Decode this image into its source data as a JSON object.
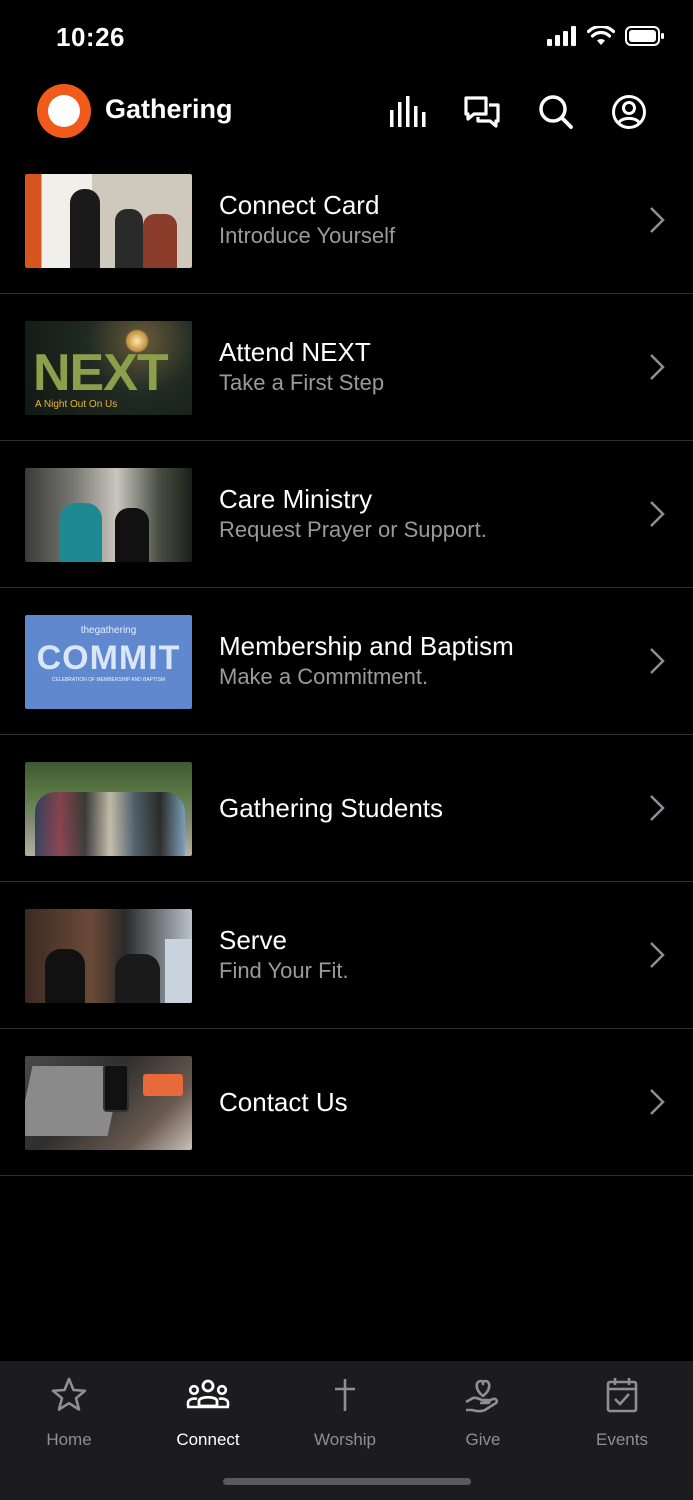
{
  "status_bar": {
    "time": "10:26"
  },
  "header": {
    "app_name": "Gathering"
  },
  "items": [
    {
      "title": "Connect Card",
      "subtitle": "Introduce Yourself"
    },
    {
      "title": "Attend NEXT",
      "subtitle": "Take a First Step",
      "thumb_text": "NEXT",
      "thumb_caption": "A Night Out On Us"
    },
    {
      "title": "Care Ministry",
      "subtitle": "Request Prayer or Support."
    },
    {
      "title": "Membership and Baptism",
      "subtitle": "Make a Commitment.",
      "thumb_brand": "thegathering",
      "thumb_text": "COMMIT",
      "thumb_caption": "CELEBRATION OF MEMBERSHIP AND BAPTISM"
    },
    {
      "title": "Gathering Students",
      "subtitle": ""
    },
    {
      "title": "Serve",
      "subtitle": "Find Your Fit."
    },
    {
      "title": "Contact Us",
      "subtitle": ""
    }
  ],
  "tabs": [
    {
      "label": "Home",
      "icon": "star-icon"
    },
    {
      "label": "Connect",
      "icon": "people-icon",
      "active": true
    },
    {
      "label": "Worship",
      "icon": "cross-icon"
    },
    {
      "label": "Give",
      "icon": "heart-hand-icon"
    },
    {
      "label": "Events",
      "icon": "calendar-check-icon"
    }
  ],
  "colors": {
    "background": "#000000",
    "brand": "#f05a1a",
    "tabbar": "#1c1c1e",
    "subtitle": "#9a9a9a"
  }
}
